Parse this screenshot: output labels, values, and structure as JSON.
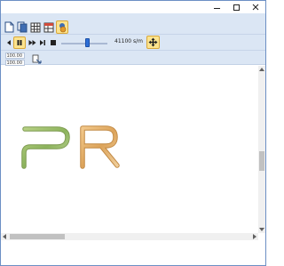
{
  "window": {
    "controls": [
      "minimize",
      "maximize",
      "close"
    ]
  },
  "ribbon": {
    "file_tools": [
      {
        "icon": "new-page-icon"
      },
      {
        "icon": "copy-pages-icon"
      },
      {
        "icon": "grid-icon"
      },
      {
        "icon": "table-icon"
      },
      {
        "icon": "robot-settings-icon",
        "active": true
      }
    ],
    "playback": {
      "buttons": [
        {
          "icon": "step-back-icon"
        },
        {
          "icon": "pause-icon",
          "active": true
        },
        {
          "icon": "fast-forward-icon"
        },
        {
          "icon": "skip-end-icon"
        },
        {
          "icon": "stop-icon"
        }
      ],
      "speed_fraction": 0.55,
      "speed_label": "41100 s/m"
    },
    "dimensions": {
      "width_value": "100.00",
      "height_value": "100.00"
    }
  },
  "canvas": {
    "letters": [
      {
        "char": "P",
        "color": "#9bbf6a"
      },
      {
        "char": "R",
        "color": "#e6b36a"
      }
    ]
  },
  "colors": {
    "ribbon_bg": "#dbe6f4",
    "active_highlight": "#fbe38e",
    "slider_thumb": "#2d6fd6"
  }
}
